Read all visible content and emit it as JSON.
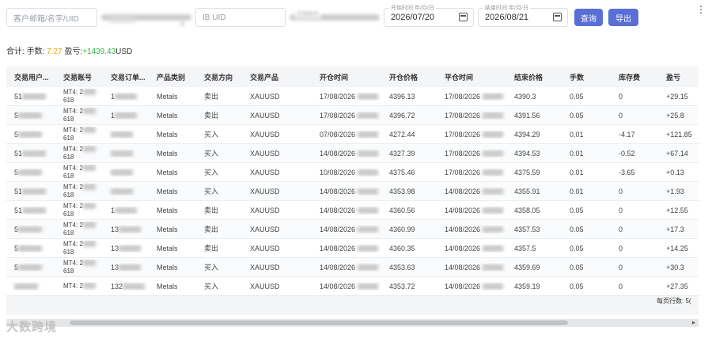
{
  "filters": {
    "email_placeholder": "客户邮箱/名字/UID",
    "ib_placeholder": "IB UID",
    "account_label": "交易账号",
    "start_label": "开始时间 年/月/日",
    "start_value": "2026/07/20",
    "end_label": "结束时间 年/月/日",
    "end_value": "2026/08/21",
    "query_button": "查询",
    "export_button": "导出"
  },
  "summary": {
    "label": "合计:",
    "lots_label": "手数:",
    "lots_value": "7.27",
    "pnl_label": "盈亏:",
    "pnl_value": "+1439.43",
    "currency": "USD"
  },
  "columns": [
    "交易用户...",
    "交易账号",
    "交易订单...",
    "产品类别",
    "交易方向",
    "交易产品",
    "开仓时间",
    "开仓价格",
    "平仓时间",
    "结束价格",
    "手数",
    "库存费",
    "盈亏"
  ],
  "rows": [
    {
      "user": "51",
      "acct1": "MT4: 2",
      "acct2": "618",
      "order": "1",
      "cat": "Metals",
      "dir": "卖出",
      "prod": "XAUUSD",
      "open_t": "17/08/2026",
      "open_p": "4396.13",
      "close_t": "17/08/2026",
      "close_p": "4390.3",
      "lots": "0.05",
      "swap": "0",
      "pnl": "+29.15"
    },
    {
      "user": "5",
      "acct1": "MT4: 2",
      "acct2": "618",
      "order": "1",
      "cat": "Metals",
      "dir": "卖出",
      "prod": "XAUUSD",
      "open_t": "17/08/2026",
      "open_p": "4396.72",
      "close_t": "17/08/2026",
      "close_p": "4391.56",
      "lots": "0.05",
      "swap": "0",
      "pnl": "+25.8"
    },
    {
      "user": "5",
      "acct1": "MT4: 2",
      "acct2": "618",
      "order": "",
      "cat": "Metals",
      "dir": "买入",
      "prod": "XAUUSD",
      "open_t": "07/08/2026",
      "open_p": "4272.44",
      "close_t": "17/08/2026",
      "close_p": "4394.29",
      "lots": "0.01",
      "swap": "-4.17",
      "pnl": "+121.85"
    },
    {
      "user": "51",
      "acct1": "MT4: 2",
      "acct2": "618",
      "order": "",
      "cat": "Metals",
      "dir": "买入",
      "prod": "XAUUSD",
      "open_t": "14/08/2026",
      "open_p": "4327.39",
      "close_t": "17/08/2026",
      "close_p": "4394.53",
      "lots": "0.01",
      "swap": "-0.52",
      "pnl": "+67.14"
    },
    {
      "user": "5",
      "acct1": "MT4: 2",
      "acct2": "618",
      "order": "",
      "cat": "Metals",
      "dir": "买入",
      "prod": "XAUUSD",
      "open_t": "10/08/2026",
      "open_p": "4375.46",
      "close_t": "17/08/2026",
      "close_p": "4375.59",
      "lots": "0.01",
      "swap": "-3.65",
      "pnl": "+0.13"
    },
    {
      "user": "51",
      "acct1": "MT4: 2",
      "acct2": "618",
      "order": "",
      "cat": "Metals",
      "dir": "买入",
      "prod": "XAUUSD",
      "open_t": "14/08/2026",
      "open_p": "4353.98",
      "close_t": "14/08/2026",
      "close_p": "4355.91",
      "lots": "0.01",
      "swap": "0",
      "pnl": "+1.93"
    },
    {
      "user": "51",
      "acct1": "MT4: 2",
      "acct2": "618",
      "order": "1",
      "cat": "Metals",
      "dir": "卖出",
      "prod": "XAUUSD",
      "open_t": "14/08/2026",
      "open_p": "4360.56",
      "close_t": "14/08/2026",
      "close_p": "4358.05",
      "lots": "0.05",
      "swap": "0",
      "pnl": "+12.55"
    },
    {
      "user": "5",
      "acct1": "MT4: 2",
      "acct2": "618",
      "order": "13",
      "cat": "Metals",
      "dir": "卖出",
      "prod": "XAUUSD",
      "open_t": "14/08/2026",
      "open_p": "4360.99",
      "close_t": "14/08/2026",
      "close_p": "4357.53",
      "lots": "0.05",
      "swap": "0",
      "pnl": "+17.3"
    },
    {
      "user": "5",
      "acct1": "MT4: 2",
      "acct2": "618",
      "order": "13",
      "cat": "Metals",
      "dir": "卖出",
      "prod": "XAUUSD",
      "open_t": "14/08/2026",
      "open_p": "4360.35",
      "close_t": "14/08/2026",
      "close_p": "4357.5",
      "lots": "0.05",
      "swap": "0",
      "pnl": "+14.25"
    },
    {
      "user": "5",
      "acct1": "MT4: 2",
      "acct2": "618",
      "order": "13",
      "cat": "Metals",
      "dir": "买入",
      "prod": "XAUUSD",
      "open_t": "14/08/2026",
      "open_p": "4353.63",
      "close_t": "14/08/2026",
      "close_p": "4359.69",
      "lots": "0.05",
      "swap": "0",
      "pnl": "+30.3"
    },
    {
      "user": "",
      "acct1": "MT4: 2",
      "acct2": "",
      "order": "132",
      "cat": "Metals",
      "dir": "买入",
      "prod": "XAUUSD",
      "open_t": "14/08/2026",
      "open_p": "4353.72",
      "close_t": "14/08/2026",
      "close_p": "4359.19",
      "lots": "0.05",
      "swap": "0",
      "pnl": "+27.35"
    }
  ],
  "footer": {
    "per_page_label": "每页行数:",
    "per_page_value": "5("
  },
  "watermark": "大数跨境",
  "icons": {
    "calendar": "calendar-icon",
    "more": "more-vertical-icon",
    "caret": "caret-icon"
  }
}
